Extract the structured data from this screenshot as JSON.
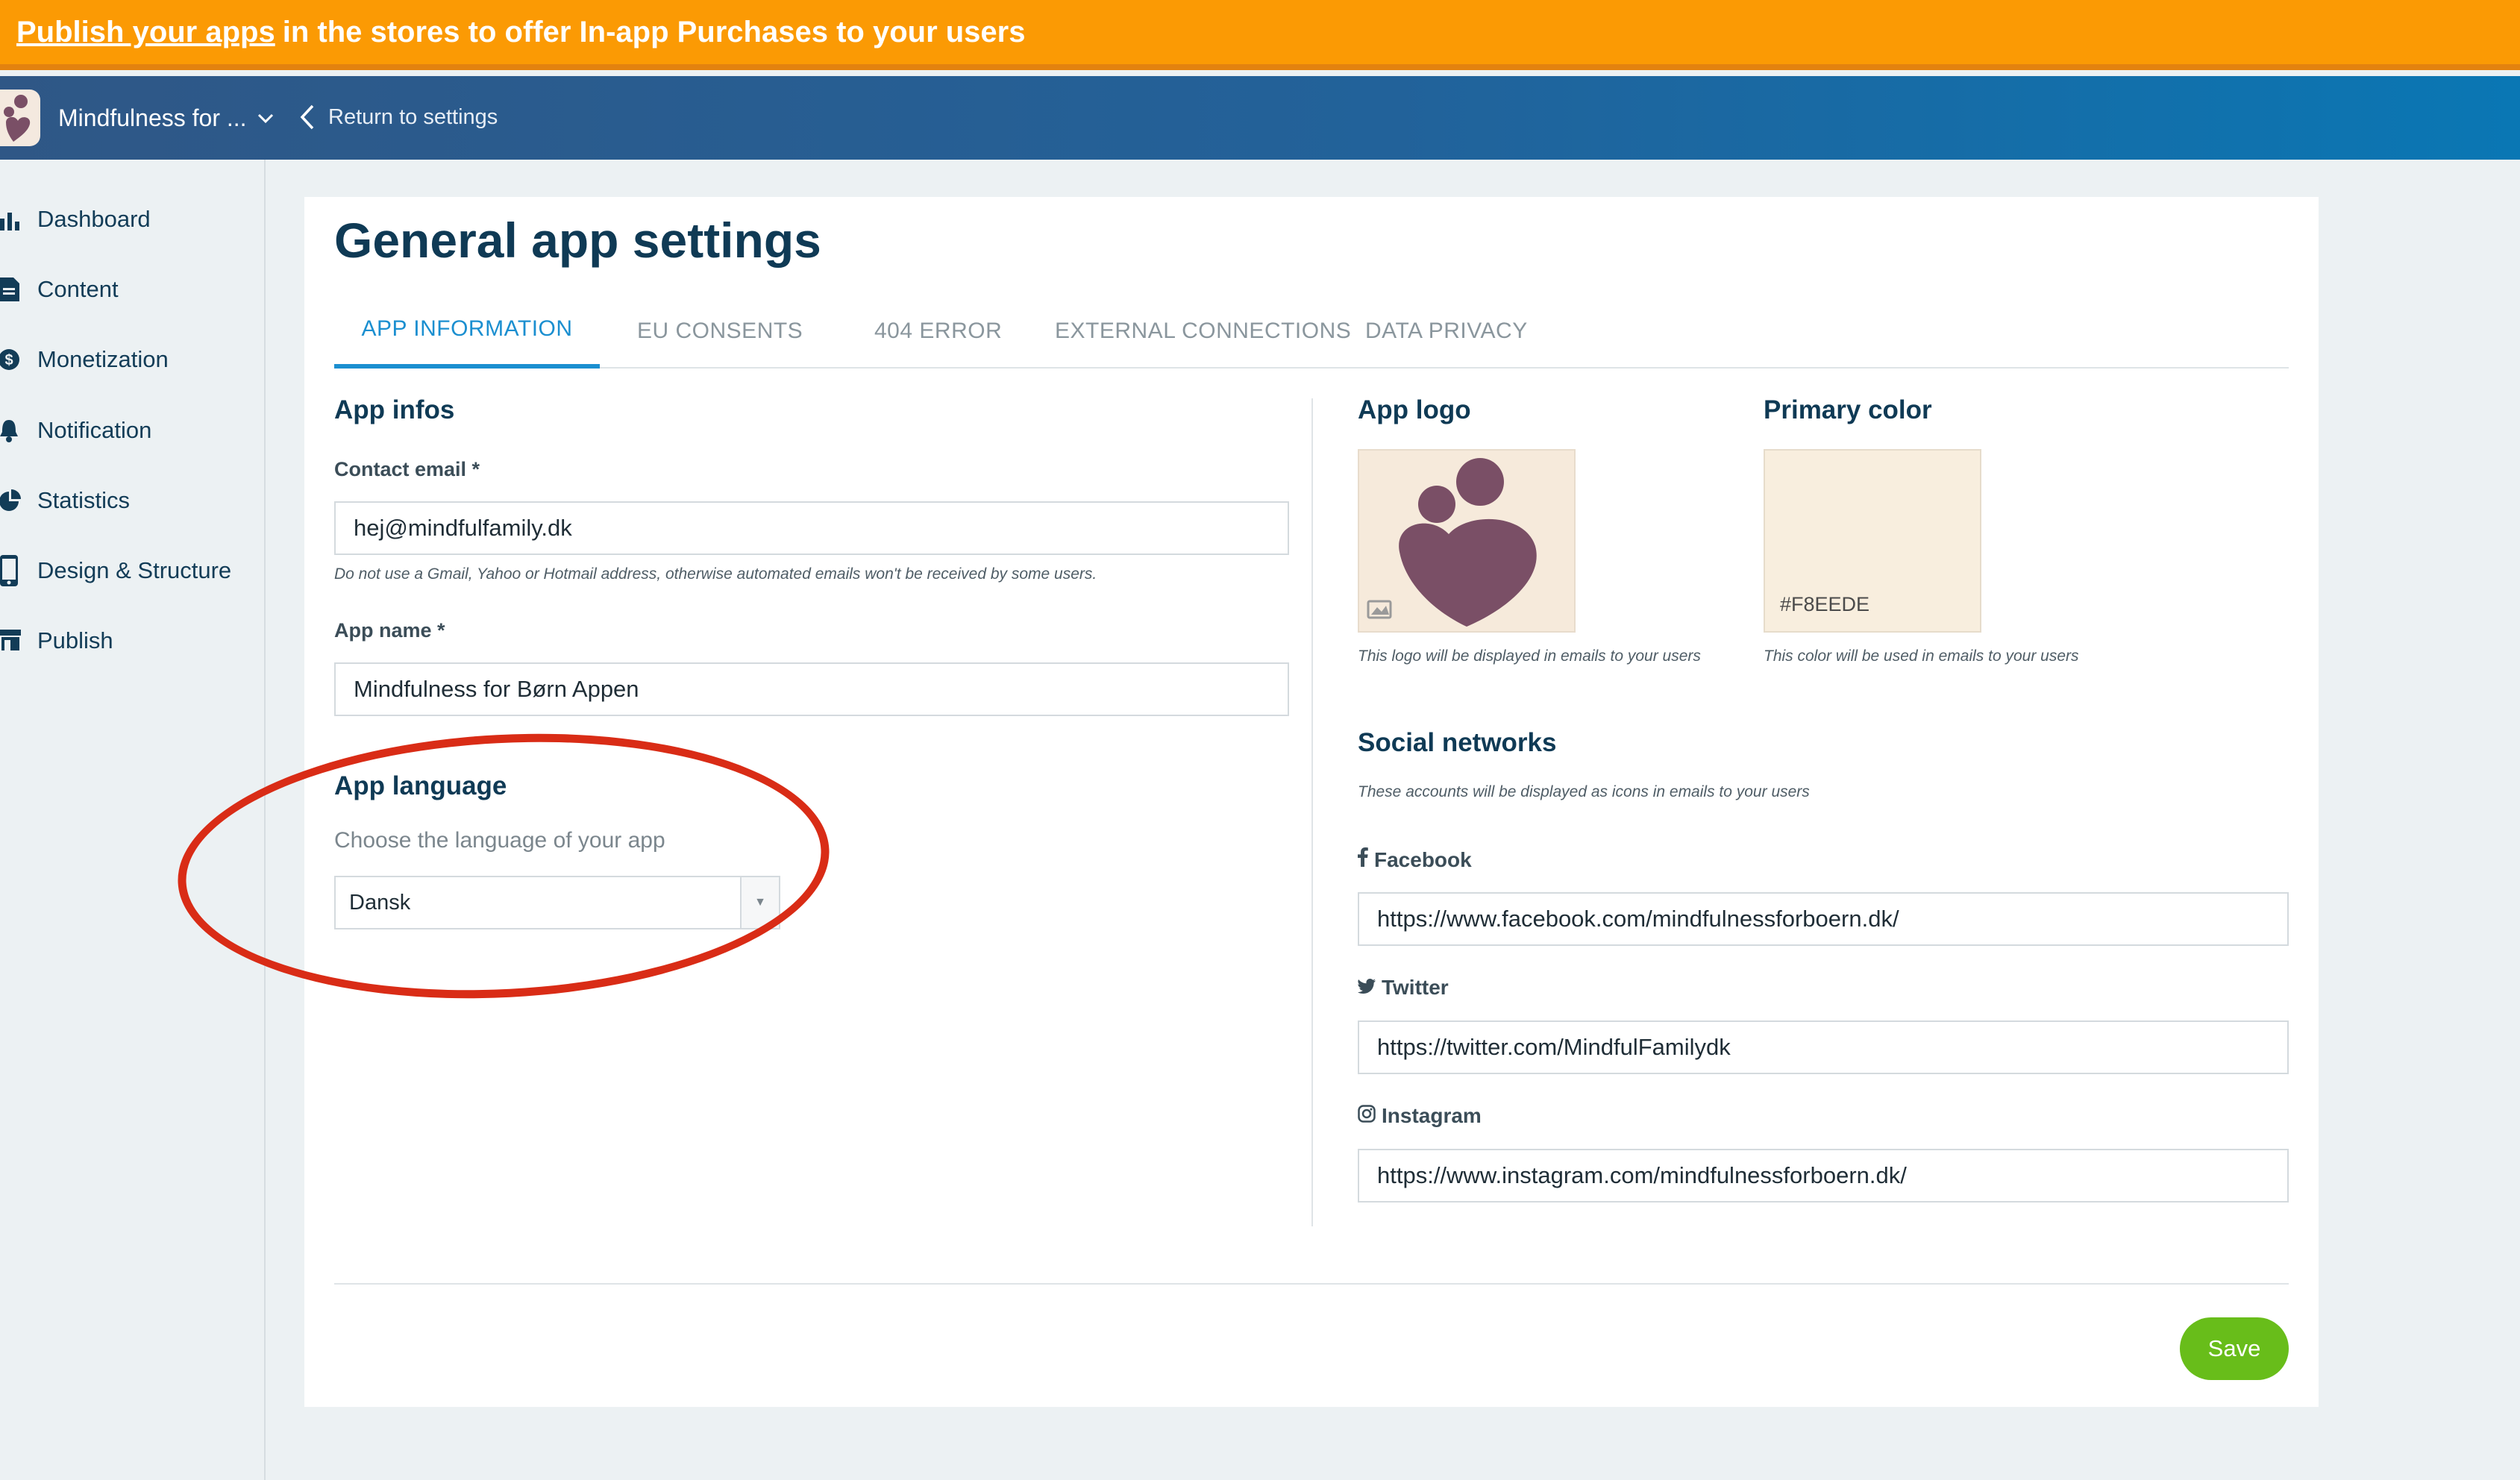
{
  "promo": {
    "link_text": "Publish your apps",
    "rest_text": "in the stores to offer In-app Purchases to your users"
  },
  "topbar": {
    "app_name": "Mindfulness for ...",
    "return_label": "Return to settings"
  },
  "sidebar": {
    "items": [
      {
        "label": "Dashboard",
        "icon": "bar-chart-icon"
      },
      {
        "label": "Content",
        "icon": "document-icon"
      },
      {
        "label": "Monetization",
        "icon": "dollar-icon"
      },
      {
        "label": "Notification",
        "icon": "bell-icon"
      },
      {
        "label": "Statistics",
        "icon": "pie-chart-icon"
      },
      {
        "label": "Design & Structure",
        "icon": "phone-icon"
      },
      {
        "label": "Publish",
        "icon": "store-icon"
      }
    ]
  },
  "page": {
    "title": "General app settings",
    "tabs": [
      {
        "label": "APP INFORMATION",
        "active": true
      },
      {
        "label": "EU CONSENTS",
        "active": false
      },
      {
        "label": "404 ERROR",
        "active": false
      },
      {
        "label": "EXTERNAL CONNECTIONS",
        "active": false
      },
      {
        "label": "DATA PRIVACY",
        "active": false
      }
    ]
  },
  "app_infos": {
    "title": "App infos",
    "contact_email_label": "Contact email *",
    "contact_email_value": "hej@mindfulfamily.dk",
    "contact_email_help": "Do not use a Gmail, Yahoo or Hotmail address, otherwise automated emails won't be received by some users.",
    "app_name_label": "App name *",
    "app_name_value": "Mindfulness for Børn Appen"
  },
  "app_language": {
    "title": "App language",
    "subtitle": "Choose the language of your app",
    "selected": "Dansk"
  },
  "app_logo": {
    "title": "App logo",
    "help": "This logo will be displayed in emails to your users"
  },
  "primary_color": {
    "title": "Primary color",
    "value": "#F8EEDE",
    "help": "This color will be used in emails to your users"
  },
  "social": {
    "title": "Social networks",
    "help": "These accounts will be displayed as icons in emails to your users",
    "facebook_label": "Facebook",
    "facebook_value": "https://www.facebook.com/mindfulnessforboern.dk/",
    "twitter_label": "Twitter",
    "twitter_value": "https://twitter.com/MindfulFamilydk",
    "instagram_label": "Instagram",
    "instagram_value": "https://www.instagram.com/mindfulnessforboern.dk/"
  },
  "actions": {
    "save_label": "Save"
  },
  "colors": {
    "banner": "#fb9a04",
    "accent": "#1b8fd0",
    "save": "#68bd1a",
    "annotation": "#d92c16",
    "logo_heart": "#7a4f66"
  }
}
